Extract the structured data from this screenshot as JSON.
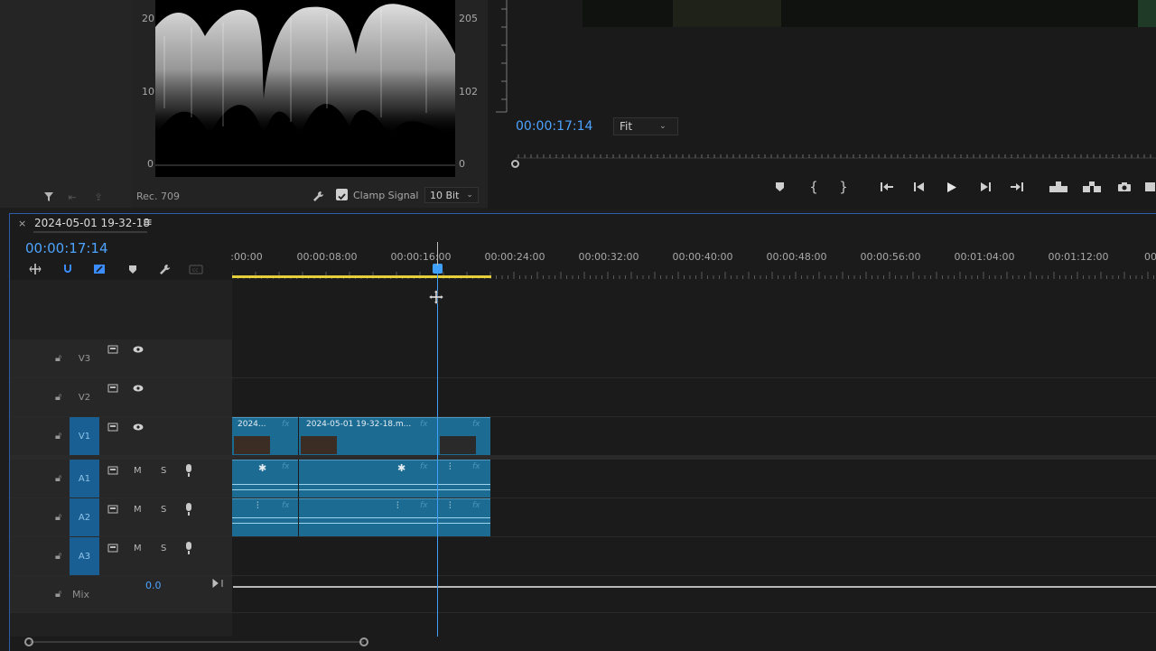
{
  "scope": {
    "left_axis": [
      "20",
      "10",
      "0"
    ],
    "right_axis": [
      "205",
      "102",
      "0"
    ],
    "colorspace": "Rec. 709",
    "clamp_label": "Clamp Signal",
    "bit_depth": "10 Bit"
  },
  "program": {
    "timecode": "00:00:17:14",
    "zoom": "Fit"
  },
  "timeline": {
    "sequence_name": "2024-05-01 19-32-18",
    "timecode": "00:00:17:14",
    "ruler": [
      ":00:00",
      "00:00:08:00",
      "00:00:16:00",
      "00:00:24:00",
      "00:00:32:00",
      "00:00:40:00",
      "00:00:48:00",
      "00:00:56:00",
      "00:01:04:00",
      "00:01:12:00",
      "00"
    ],
    "tracks": {
      "v3": "V3",
      "v2": "V2",
      "v1": "V1",
      "a1": "A1",
      "a2": "A2",
      "a3": "A3",
      "mix": "Mix",
      "mix_value": "0.0",
      "m": "M",
      "s": "S"
    },
    "clips": {
      "v1_a": "2024...",
      "v1_b": "2024-05-01 19-32-18.m...",
      "fx": "fx"
    }
  },
  "icons": [
    "filter-icon",
    "wrench-icon",
    "marker-icon",
    "play-icon",
    "camera-icon",
    "snap-icon",
    "lock-icon",
    "eye-icon",
    "mic-icon"
  ]
}
